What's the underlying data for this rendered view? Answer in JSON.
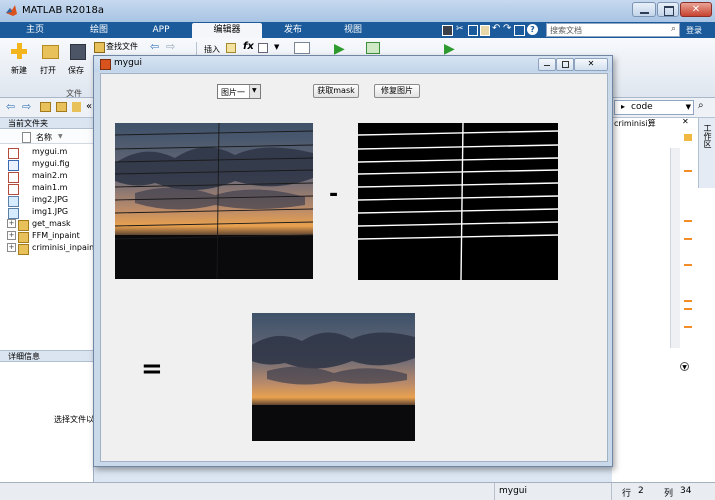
{
  "app": {
    "title": "MATLAB R2018a"
  },
  "tabs": [
    "主页",
    "绘图",
    "APP",
    "编辑器",
    "发布",
    "视图"
  ],
  "active_tab": "编辑器",
  "search": {
    "placeholder": "搜索文档"
  },
  "login": "登录",
  "ribbon": {
    "new": "新建",
    "open": "打开",
    "save": "保存",
    "find_files": "查找文件",
    "insert": "插入",
    "fx": "fx",
    "section_file": "文件"
  },
  "address": {
    "arrows": "«",
    "code": "code"
  },
  "current_folder": {
    "title": "当前文件夹",
    "name_header": "名称",
    "files": [
      {
        "name": "mygui.m",
        "type": "m"
      },
      {
        "name": "mygui.fig",
        "type": "fig"
      },
      {
        "name": "main2.m",
        "type": "m"
      },
      {
        "name": "main1.m",
        "type": "m"
      },
      {
        "name": "img2.JPG",
        "type": "img"
      },
      {
        "name": "img1.JPG",
        "type": "img"
      },
      {
        "name": "get_mask",
        "type": "folder"
      },
      {
        "name": "FFM_inpaint",
        "type": "folder"
      },
      {
        "name": "criminisi_inpaint",
        "type": "folder"
      }
    ]
  },
  "details": {
    "title": "详细信息",
    "hint": "选择文件以"
  },
  "right_panel": {
    "label": "criminisi算",
    "side_tab": "工作区"
  },
  "gui": {
    "title": "mygui",
    "popup_value": "图片一",
    "btn_mask": "获取mask",
    "btn_repair": "修复图片",
    "minus": "-",
    "equals": "="
  },
  "status": {
    "script": "mygui",
    "row_label": "行",
    "row": "2",
    "col_label": "列",
    "col": "34"
  }
}
